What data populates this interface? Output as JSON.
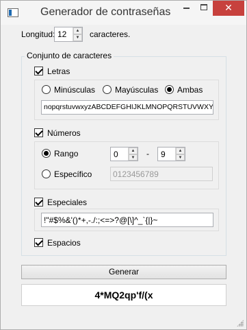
{
  "window": {
    "title": "Generador de contraseñas",
    "minimize_glyph": "",
    "close_glyph": "✕"
  },
  "length": {
    "label": "Longitud:",
    "value": "12",
    "suffix": "caracteres."
  },
  "charset": {
    "title": "Conjunto de caracteres",
    "letters": {
      "label": "Letras",
      "checked": true,
      "options": {
        "lower": "Minúsculas",
        "upper": "Mayúsculas",
        "both": "Ambas"
      },
      "selected": "Ambas",
      "chars": "nopqrstuvwxyzABCDEFGHIJKLMNOPQRSTUVWXYZ"
    },
    "numbers": {
      "label": "Números",
      "checked": true,
      "range_label": "Rango",
      "range_from": "0",
      "range_sep": "-",
      "range_to": "9",
      "specific_label": "Específico",
      "specific_placeholder": "0123456789",
      "selected": "Rango"
    },
    "specials": {
      "label": "Especiales",
      "checked": true,
      "chars": "!\"#$%&'()*+,-./:;<=>?@[\\]^_`{|}~"
    },
    "spaces": {
      "label": "Espacios",
      "checked": true
    }
  },
  "generate_label": "Generar",
  "result": "4*MQ2qp'f/(x",
  "colors": {
    "close_button": "#c7413d",
    "window_bg": "#f0f0f0"
  }
}
